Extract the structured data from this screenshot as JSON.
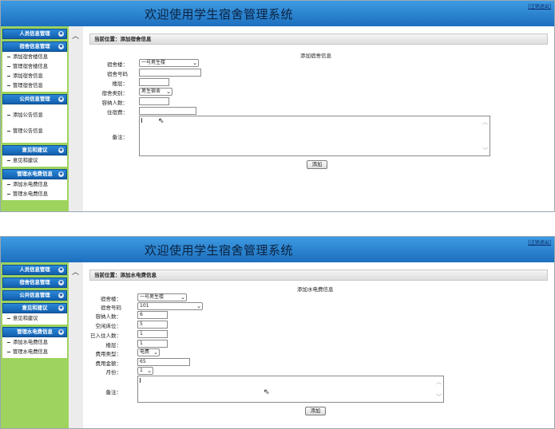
{
  "app_title": "欢迎使用学生宿舍管理系统",
  "logout_label": "[注销退出]",
  "screen1": {
    "sidebar": {
      "categories": [
        {
          "label": "人员信息管理",
          "items": []
        },
        {
          "label": "宿舍信息管理",
          "items": [
            "添加宿舍楼信息",
            "管理宿舍楼信息",
            "添加宿舍信息",
            "管理宿舍信息"
          ]
        },
        {
          "label": "公共信息管理",
          "items": [
            "添加公告信息",
            "管理公告信息"
          ]
        },
        {
          "label": "意见和建议",
          "items": [
            "意见和建议"
          ]
        },
        {
          "label": "管理水电费信息",
          "items": [
            "添加水电费信息",
            "管理水电费信息"
          ]
        }
      ]
    },
    "breadcrumb": "当前位置：添加宿舍信息",
    "form_title": "添加宿舍信息",
    "fields": {
      "building_label": "宿舍楼：",
      "building_value": "一号男生楼",
      "room_label": "宿舍号码",
      "room_value": "",
      "floor_label": "楼层：",
      "floor_value": "",
      "type_label": "宿舍类别：",
      "type_value": "男生宿舍",
      "capacity_label": "容纳人数：",
      "capacity_value": "",
      "fee_label": "住宿费：",
      "fee_value": "",
      "remark_label": "备注："
    },
    "submit_label": "添加"
  },
  "screen2": {
    "sidebar": {
      "categories": [
        {
          "label": "人员信息管理",
          "items": []
        },
        {
          "label": "宿舍信息管理",
          "items": []
        },
        {
          "label": "公共信息管理",
          "items": []
        },
        {
          "label": "意见和建议",
          "items": [
            "意见和建议"
          ]
        },
        {
          "label": "管理水电费信息",
          "items": [
            "添加水电费信息",
            "管理水电费信息"
          ]
        }
      ]
    },
    "breadcrumb": "当前位置：添加水电费信息",
    "form_title": "添加水电费信息",
    "fields": {
      "building_label": "宿舍楼：",
      "building_value": "一号男生楼",
      "room_label": "宿舍号码",
      "room_value": "101",
      "capacity_label": "容纳人数：",
      "capacity_value": "6",
      "free_label": "空闲床位：",
      "free_value": "5",
      "occupied_label": "已入住人数：",
      "occupied_value": "1",
      "floor_label": "楼层：",
      "floor_value": "1",
      "feetype_label": "费用类型：",
      "feetype_value": "电费",
      "amount_label": "费用金额：",
      "amount_value": "65",
      "month_label": "月份：",
      "month_value": "1",
      "remark_label": "备注："
    },
    "submit_label": "添加"
  }
}
